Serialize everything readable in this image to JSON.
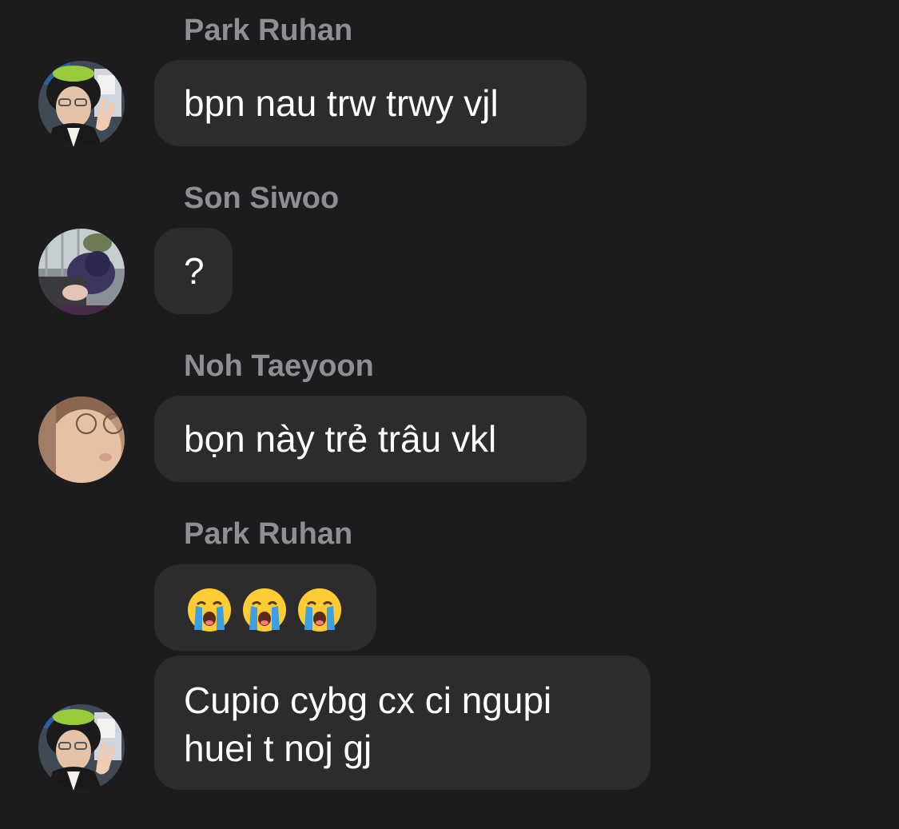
{
  "messages": [
    {
      "sender": "Park Ruhan",
      "text": "bpn nau trw trwy vjl",
      "avatar": "park-ruhan-avatar"
    },
    {
      "sender": "Son Siwoo",
      "text": "?",
      "avatar": "son-siwoo-avatar"
    },
    {
      "sender": "Noh Taeyoon",
      "text": "bọn này trẻ trâu vkl",
      "avatar": "noh-taeyoon-avatar"
    },
    {
      "sender": "Park Ruhan",
      "emojis": [
        "loudly-crying-face-icon",
        "loudly-crying-face-icon",
        "loudly-crying-face-icon"
      ],
      "avatar": "park-ruhan-avatar"
    },
    {
      "text_line1": "Cupio cybg cx ci ngupi",
      "text_line2": "huei t noj gj",
      "avatar": "park-ruhan-avatar"
    }
  ],
  "colors": {
    "background": "#1c1c1e",
    "bubble": "#2c2c2e",
    "sender_name": "#8e8e93",
    "text": "#ffffff"
  }
}
